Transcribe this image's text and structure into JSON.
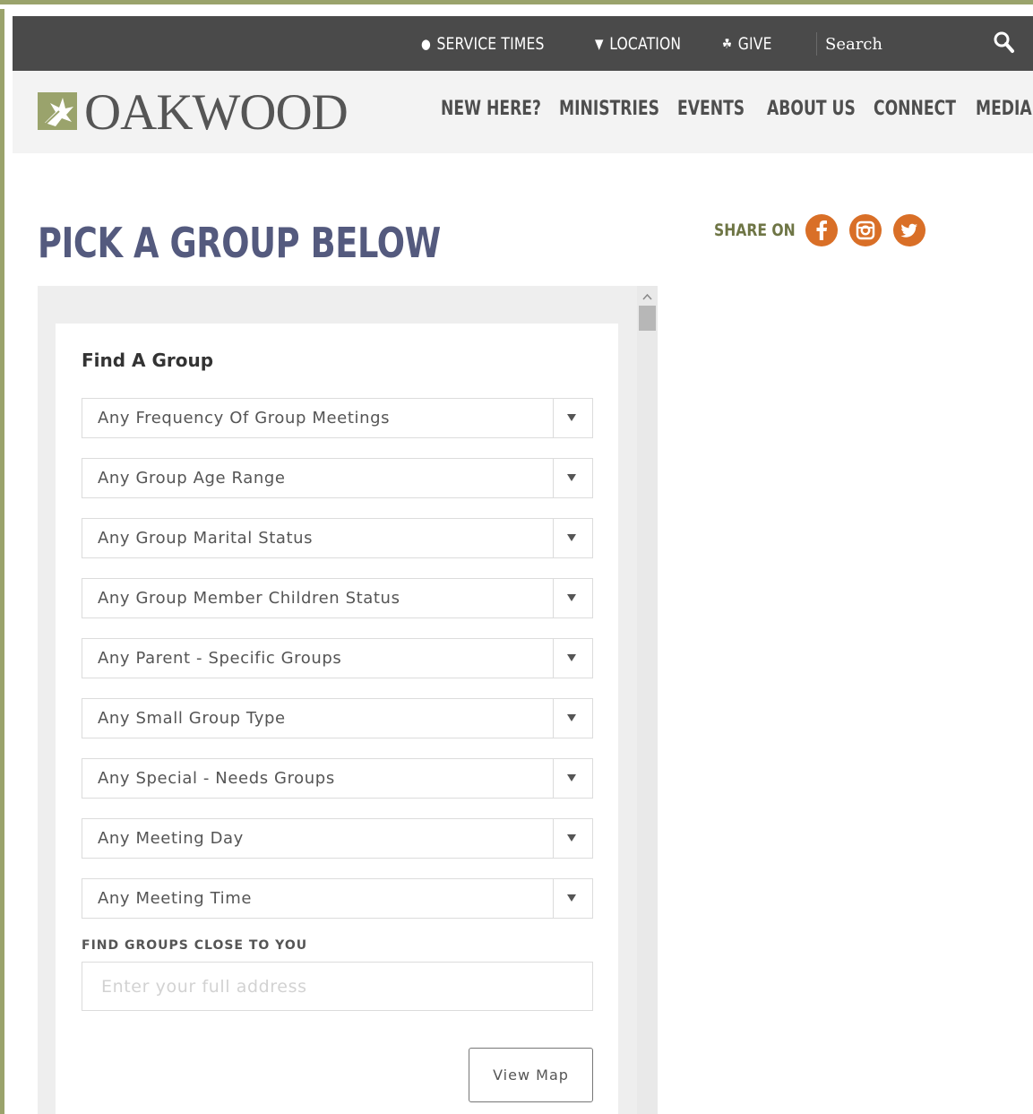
{
  "topbar": {
    "service_times": "SERVICE TIMES",
    "location": "LOCATION",
    "give": "GIVE",
    "search_placeholder": "Search"
  },
  "brand": {
    "name": "OAKWOOD",
    "accent_color": "#9aa36c"
  },
  "nav": {
    "items": [
      "NEW HERE?",
      "MINISTRIES",
      "EVENTS",
      "ABOUT US",
      "CONNECT",
      "MEDIA"
    ]
  },
  "page": {
    "title": "PICK A GROUP BELOW",
    "share_label": "SHARE ON",
    "social": [
      "facebook-icon",
      "instagram-icon",
      "twitter-icon"
    ],
    "social_color": "#d96f27"
  },
  "finder": {
    "title": "Find A Group",
    "filters": [
      "Any Frequency Of Group Meetings",
      "Any Group Age Range",
      "Any Group Marital Status",
      "Any Group Member Children Status",
      "Any Parent - Specific Groups",
      "Any Small Group Type",
      "Any Special - Needs Groups",
      "Any Meeting Day",
      "Any Meeting Time"
    ],
    "near_label": "FIND GROUPS CLOSE TO YOU",
    "address_placeholder": "Enter your full address",
    "view_map": "View Map"
  }
}
